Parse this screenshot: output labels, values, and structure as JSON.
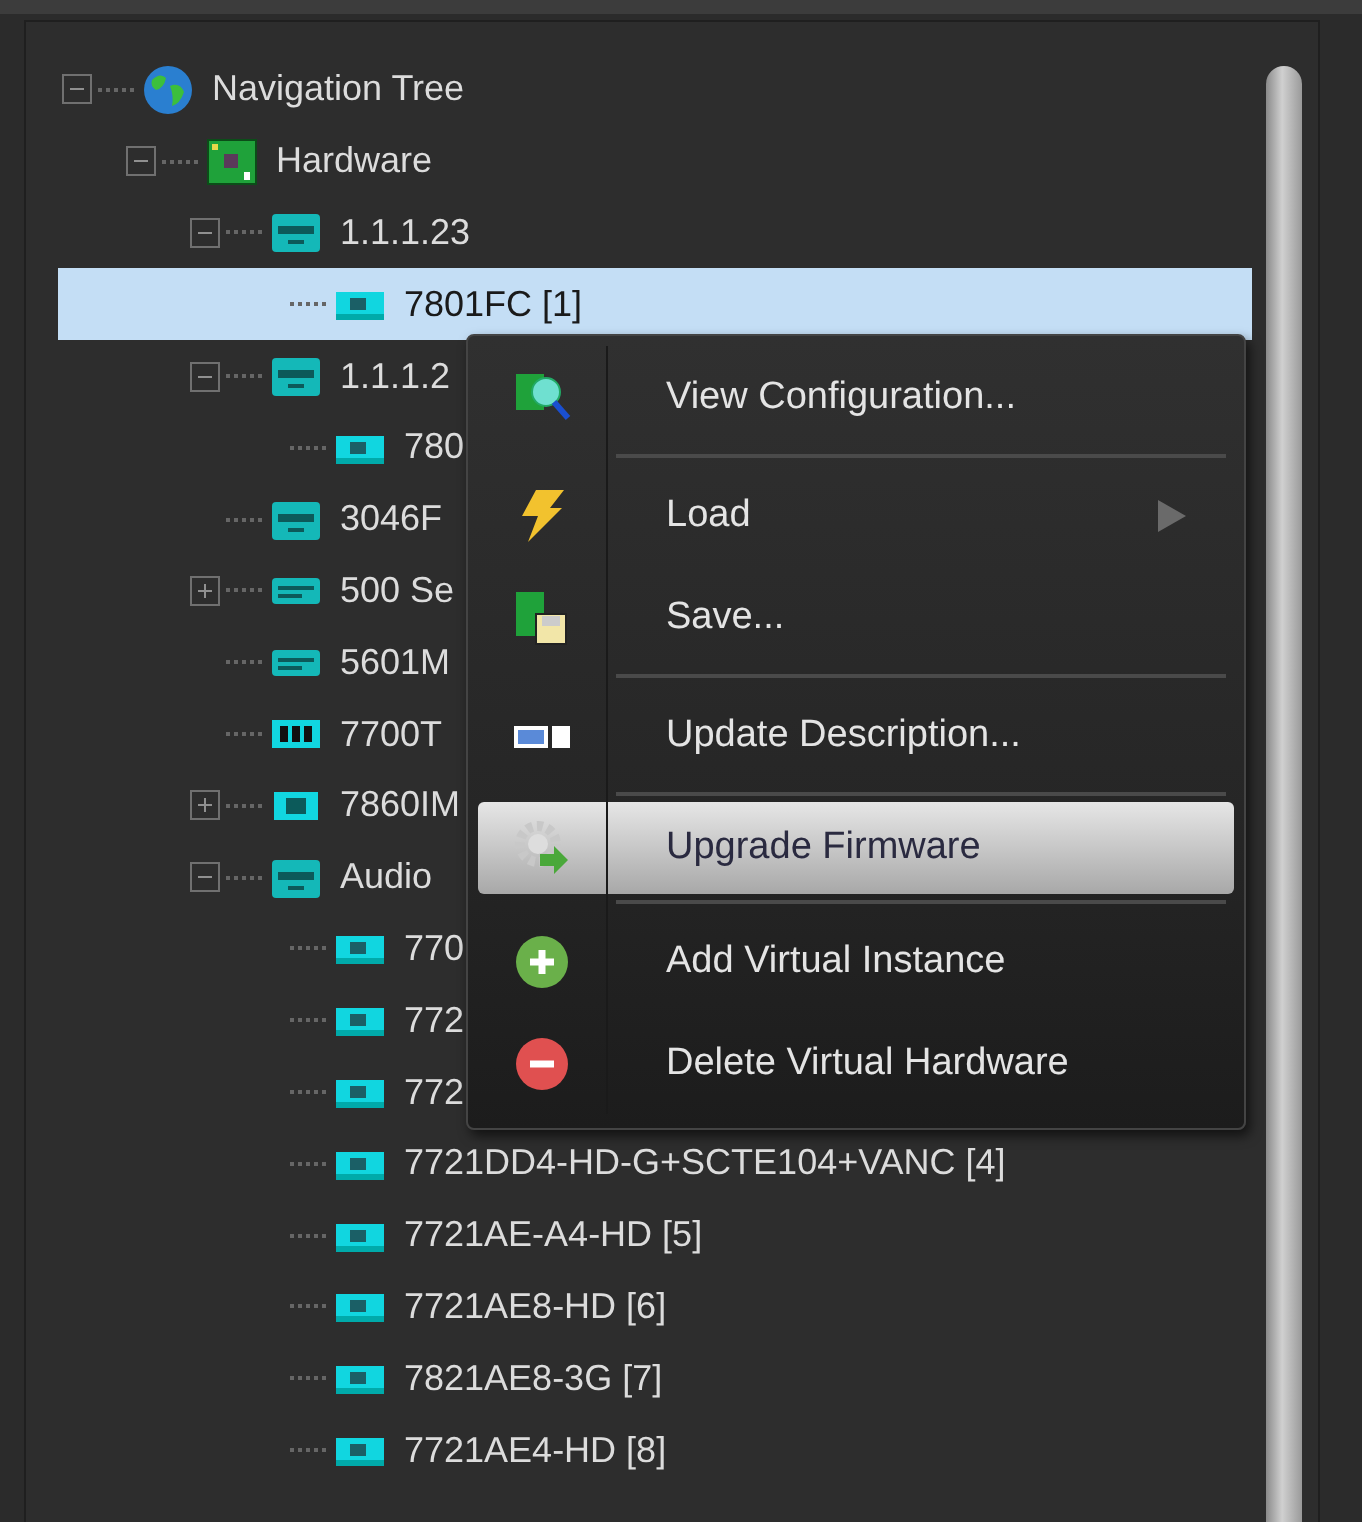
{
  "tree": [
    {
      "label": "Navigation Tree",
      "kind": "root",
      "expanded": true,
      "selected": false,
      "children": [
        {
          "label": "Hardware",
          "kind": "group",
          "expanded": true,
          "selected": false,
          "children": [
            {
              "label": "1.1.1.23",
              "kind": "frame",
              "expanded": true,
              "selected": false,
              "children": [
                {
                  "label": "7801FC  [1]",
                  "kind": "card",
                  "selected": true
                }
              ]
            },
            {
              "label": "1.1.1.2",
              "kind": "frame",
              "expanded": true,
              "selected": false,
              "children": [
                {
                  "label": "780",
                  "kind": "card",
                  "selected": false
                }
              ]
            },
            {
              "label": "3046F",
              "kind": "frame",
              "selected": false
            },
            {
              "label": "500 Se",
              "kind": "rack",
              "expanded": false,
              "selected": false
            },
            {
              "label": "5601M",
              "kind": "rack",
              "selected": false
            },
            {
              "label": "7700T",
              "kind": "tag",
              "selected": false
            },
            {
              "label": "7860IM",
              "kind": "module",
              "expanded": false,
              "selected": false
            },
            {
              "label": "Audio",
              "kind": "frame",
              "expanded": true,
              "selected": false,
              "children": [
                {
                  "label": "770",
                  "kind": "card",
                  "selected": false
                },
                {
                  "label": "772",
                  "kind": "card",
                  "selected": false
                },
                {
                  "label": "772",
                  "kind": "card",
                  "selected": false
                },
                {
                  "label": "7721DD4-HD-G+SCTE104+VANC  [4]",
                  "kind": "card",
                  "selected": false
                },
                {
                  "label": "7721AE-A4-HD  [5]",
                  "kind": "card",
                  "selected": false
                },
                {
                  "label": "7721AE8-HD  [6]",
                  "kind": "card",
                  "selected": false
                },
                {
                  "label": "7821AE8-3G  [7]",
                  "kind": "card",
                  "selected": false
                },
                {
                  "label": "7721AE4-HD  [8]",
                  "kind": "card",
                  "selected": false
                }
              ]
            }
          ]
        }
      ]
    }
  ],
  "context_menu": [
    {
      "kind": "item",
      "label": "View Configuration...",
      "selected": false,
      "submenu": false
    },
    {
      "kind": "separator"
    },
    {
      "kind": "item",
      "label": "Load",
      "selected": false,
      "submenu": true
    },
    {
      "kind": "item",
      "label": "Save...",
      "selected": false,
      "submenu": false
    },
    {
      "kind": "separator"
    },
    {
      "kind": "item",
      "label": "Update Description...",
      "selected": false,
      "submenu": false
    },
    {
      "kind": "separator"
    },
    {
      "kind": "item",
      "label": "Upgrade Firmware",
      "selected": true,
      "submenu": false
    },
    {
      "kind": "separator"
    },
    {
      "kind": "item",
      "label": "Add Virtual Instance",
      "selected": false,
      "submenu": false
    },
    {
      "kind": "item",
      "label": "Delete Virtual Hardware",
      "selected": false,
      "submenu": false
    }
  ]
}
